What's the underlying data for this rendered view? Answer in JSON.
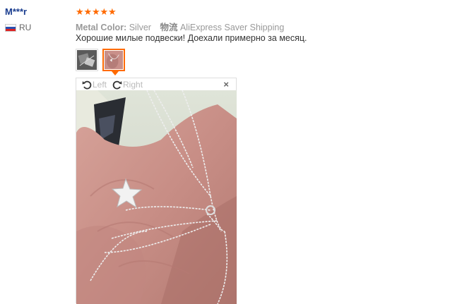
{
  "reviewer": {
    "name": "M***r",
    "country": "RU"
  },
  "rating": {
    "stars": 5,
    "max": 5
  },
  "meta": {
    "color_label": "Metal Color:",
    "color_value": "Silver",
    "shipping_label": "物流",
    "shipping_value": "AliExpress Saver Shipping"
  },
  "feedback_text": "Хорошие милые подвески! Доехали примерно за месяц.",
  "viewer": {
    "rotate_left_label": "Left",
    "rotate_right_label": "Right",
    "close_label": "×"
  },
  "colors": {
    "accent": "#ff6a00",
    "username": "#1a3d8f"
  }
}
